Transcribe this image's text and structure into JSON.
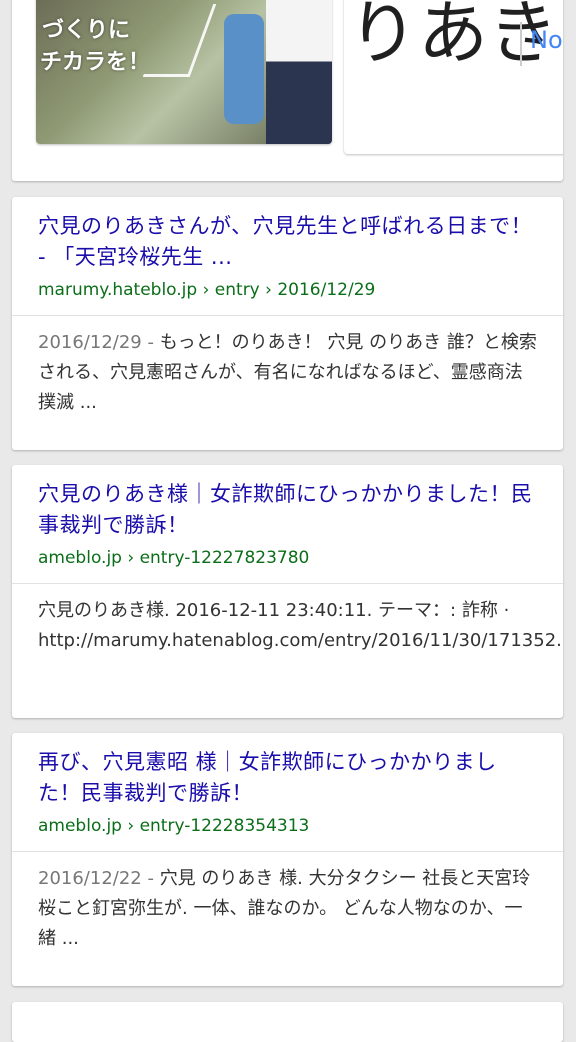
{
  "carousel": {
    "thumb_text_line1": "づくりに",
    "thumb_text_line2": "チカラを！",
    "name_tile_text": "りあき",
    "name_tile_sub": "Nori"
  },
  "results": [
    {
      "title": "穴見のりあきさんが、穴見先生と呼ばれる日まで！ - 「天宮玲桜先生 ...",
      "url": "marumy.hateblo.jp › entry › 2016/12/29",
      "date": "2016/12/29 - ",
      "snippet": "もっと！のりあき！ 穴見 のりあき 誰？と検索される、穴見憲昭さんが、有名になればなるほど、霊感商法撲滅 ..."
    },
    {
      "title": "穴見のりあき様｜女詐欺師にひっかかりました！民事裁判で勝訴！",
      "url": "ameblo.jp › entry-12227823780",
      "date": "",
      "snippet": "穴見のりあき様. 2016-12-11 23:40:11. テーマ：: 詐称 · http://marumy.hatenablog.com/entry/2016/11/30/171352."
    },
    {
      "title": "再び、穴見憲昭 様｜女詐欺師にひっかかりました！民事裁判で勝訴！",
      "url": "ameblo.jp › entry-12228354313",
      "date": "2016/12/22 - ",
      "snippet": "穴見 のりあき 様. 大分タクシー 社長と天宮玲桜こと釘宮弥生が. 一体、誰なのか。 どんな人物なのか、一緒 ..."
    }
  ]
}
